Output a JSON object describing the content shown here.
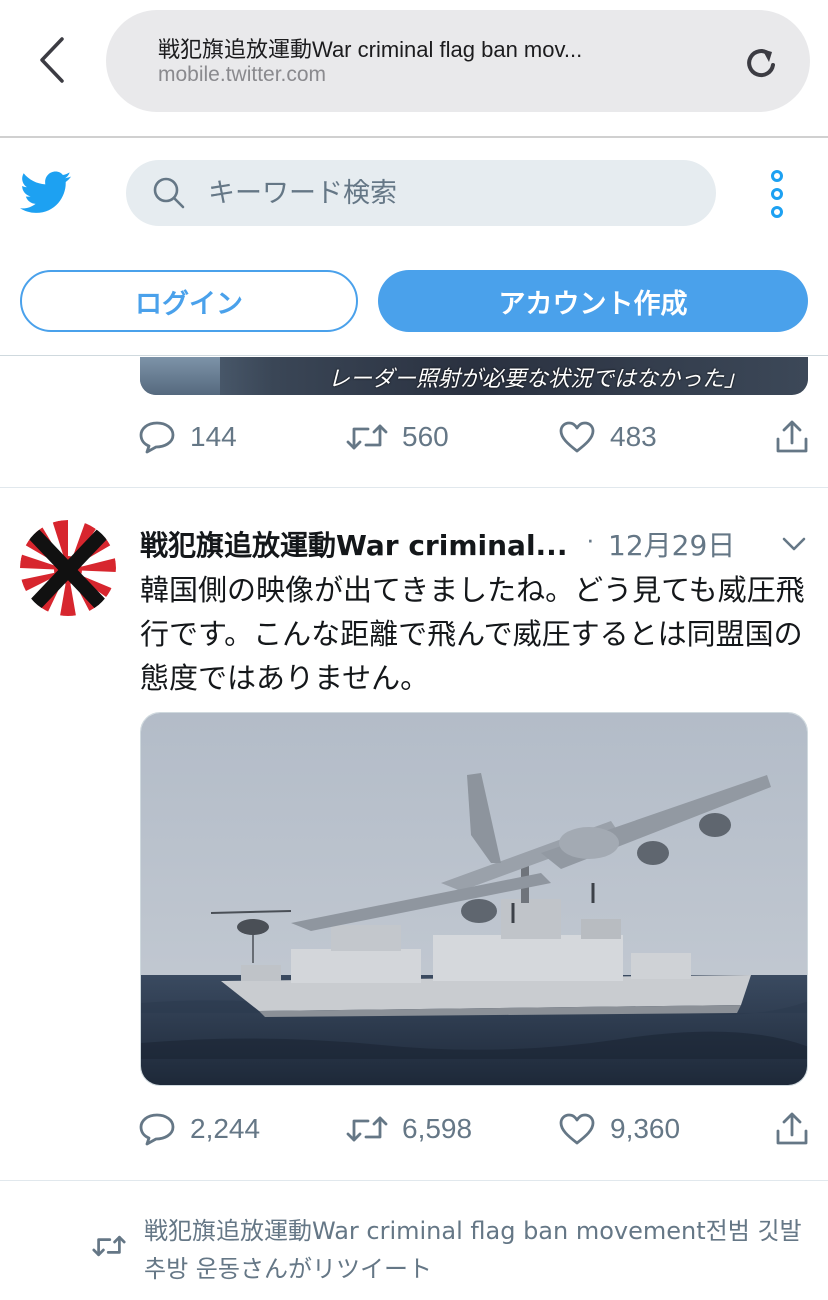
{
  "browser": {
    "page_title": "戦犯旗追放運動War criminal flag ban mov...",
    "domain": "mobile.twitter.com",
    "back_icon": "chevron-left-icon",
    "reload_icon": "reload-icon"
  },
  "header": {
    "logo_icon": "twitter-bird-icon",
    "search_placeholder": "キーワード検索",
    "login_label": "ログイン",
    "signup_label": "アカウント作成",
    "more_icon": "vertical-dots-icon",
    "accent_color": "#4aa1eb"
  },
  "previous_tweet": {
    "media_caption": "レーダー照射が必要な状況ではなかった」",
    "replies": "144",
    "retweets": "560",
    "likes": "483"
  },
  "tweet": {
    "user_name": "戦犯旗追放運動War criminal...",
    "separator": "·",
    "date": "12月29日",
    "text": "韓国側の映像が出てきましたね。どう見ても威圧飛行です。こんな距離で飛んで威圧するとは同盟国の態度ではありません。",
    "replies": "2,244",
    "retweets": "6,598",
    "likes": "9,360"
  },
  "retweet_context": {
    "text": "戦犯旗追放運動War criminal flag ban movement전범 깃발 추방 운동さんがリツイート"
  }
}
